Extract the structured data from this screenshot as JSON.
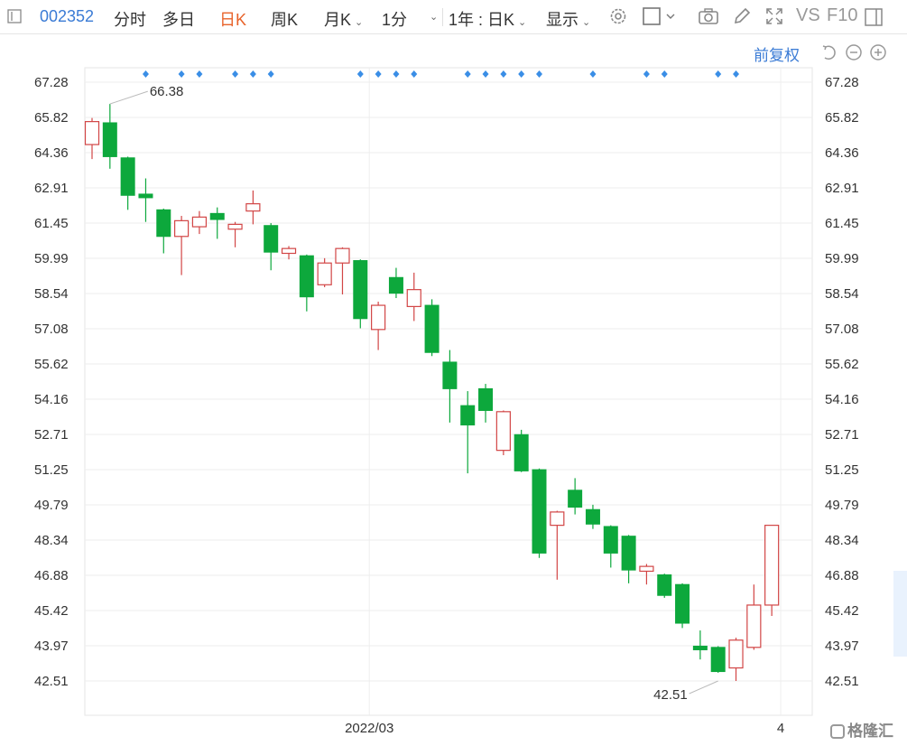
{
  "toolbar": {
    "stock_code": "002352",
    "tab_intraday": "分时",
    "tab_multiday": "多日",
    "tab_daily": "日K",
    "tab_weekly": "周K",
    "tab_monthly": "月K",
    "tab_minute": "1分",
    "range_period": "1年 : 日K",
    "display_menu": "显示",
    "vs_label": "VS",
    "f10_label": "F10"
  },
  "subbar": {
    "adjust_mode": "前复权"
  },
  "colors": {
    "up": "#d24545",
    "down": "#0da83c",
    "marker": "#3a8ee6",
    "grid": "#eeeeee",
    "active_tab": "#e8632a",
    "link": "#3a7bd5"
  },
  "chart_data": {
    "type": "candlestick",
    "y_ticks": [
      "67.28",
      "65.82",
      "64.36",
      "62.91",
      "61.45",
      "59.99",
      "58.54",
      "57.08",
      "55.62",
      "54.16",
      "52.71",
      "51.25",
      "49.79",
      "48.34",
      "46.88",
      "45.42",
      "43.97",
      "42.51"
    ],
    "ylim": [
      42.51,
      67.28
    ],
    "x_labels": [
      {
        "index": 15.5,
        "label": "2022/03"
      },
      {
        "index": 38.5,
        "label": "4"
      }
    ],
    "max_annotation": {
      "index": 1,
      "value": 66.38,
      "label": "66.38"
    },
    "min_annotation": {
      "index": 35,
      "value": 42.51,
      "label": "42.51"
    },
    "event_marker_indices": [
      3,
      5,
      6,
      8,
      9,
      10,
      15,
      16,
      17,
      18,
      21,
      22,
      23,
      24,
      25,
      28,
      31,
      32,
      35,
      36
    ],
    "candles": [
      {
        "o": 64.7,
        "c": 65.65,
        "h": 65.8,
        "l": 64.1
      },
      {
        "o": 65.6,
        "c": 64.2,
        "h": 66.38,
        "l": 63.7
      },
      {
        "o": 64.15,
        "c": 62.6,
        "h": 64.2,
        "l": 62.0
      },
      {
        "o": 62.65,
        "c": 62.5,
        "h": 63.3,
        "l": 61.5
      },
      {
        "o": 62.0,
        "c": 60.9,
        "h": 62.05,
        "l": 60.2
      },
      {
        "o": 60.9,
        "c": 61.55,
        "h": 61.75,
        "l": 59.3
      },
      {
        "o": 61.3,
        "c": 61.7,
        "h": 61.95,
        "l": 61.0
      },
      {
        "o": 61.85,
        "c": 61.6,
        "h": 62.1,
        "l": 60.8
      },
      {
        "o": 61.2,
        "c": 61.4,
        "h": 61.5,
        "l": 60.45
      },
      {
        "o": 61.95,
        "c": 62.25,
        "h": 62.8,
        "l": 61.4
      },
      {
        "o": 61.35,
        "c": 60.25,
        "h": 61.45,
        "l": 59.5
      },
      {
        "o": 60.2,
        "c": 60.4,
        "h": 60.5,
        "l": 59.95
      },
      {
        "o": 60.1,
        "c": 58.4,
        "h": 60.15,
        "l": 57.8
      },
      {
        "o": 58.9,
        "c": 59.8,
        "h": 60.0,
        "l": 58.8
      },
      {
        "o": 59.8,
        "c": 60.4,
        "h": 60.45,
        "l": 58.5
      },
      {
        "o": 59.9,
        "c": 57.5,
        "h": 59.95,
        "l": 57.1
      },
      {
        "o": 57.05,
        "c": 58.05,
        "h": 58.2,
        "l": 56.2
      },
      {
        "o": 59.2,
        "c": 58.55,
        "h": 59.6,
        "l": 58.35
      },
      {
        "o": 58.0,
        "c": 58.7,
        "h": 59.4,
        "l": 57.4
      },
      {
        "o": 58.05,
        "c": 56.1,
        "h": 58.3,
        "l": 55.95
      },
      {
        "o": 55.7,
        "c": 54.6,
        "h": 56.2,
        "l": 53.2
      },
      {
        "o": 53.9,
        "c": 53.1,
        "h": 54.5,
        "l": 51.1
      },
      {
        "o": 54.6,
        "c": 53.7,
        "h": 54.8,
        "l": 53.2
      },
      {
        "o": 52.05,
        "c": 53.65,
        "h": 53.7,
        "l": 51.85
      },
      {
        "o": 52.7,
        "c": 51.2,
        "h": 52.9,
        "l": 51.15
      },
      {
        "o": 51.25,
        "c": 47.8,
        "h": 51.3,
        "l": 47.6
      },
      {
        "o": 48.95,
        "c": 49.5,
        "h": 49.55,
        "l": 46.7
      },
      {
        "o": 50.4,
        "c": 49.7,
        "h": 50.9,
        "l": 49.4
      },
      {
        "o": 49.6,
        "c": 49.0,
        "h": 49.8,
        "l": 48.8
      },
      {
        "o": 48.9,
        "c": 47.8,
        "h": 48.95,
        "l": 47.2
      },
      {
        "o": 48.5,
        "c": 47.1,
        "h": 48.55,
        "l": 46.55
      },
      {
        "o": 47.05,
        "c": 47.25,
        "h": 47.35,
        "l": 46.5
      },
      {
        "o": 46.9,
        "c": 46.05,
        "h": 46.95,
        "l": 45.95
      },
      {
        "o": 46.5,
        "c": 44.9,
        "h": 46.55,
        "l": 44.7
      },
      {
        "o": 43.95,
        "c": 43.8,
        "h": 44.6,
        "l": 43.4
      },
      {
        "o": 43.9,
        "c": 42.9,
        "h": 43.95,
        "l": 42.85
      },
      {
        "o": 43.05,
        "c": 44.2,
        "h": 44.3,
        "l": 42.51
      },
      {
        "o": 43.9,
        "c": 45.65,
        "h": 46.5,
        "l": 43.8
      },
      {
        "o": 45.65,
        "c": 48.95,
        "h": 48.95,
        "l": 45.2
      }
    ]
  }
}
